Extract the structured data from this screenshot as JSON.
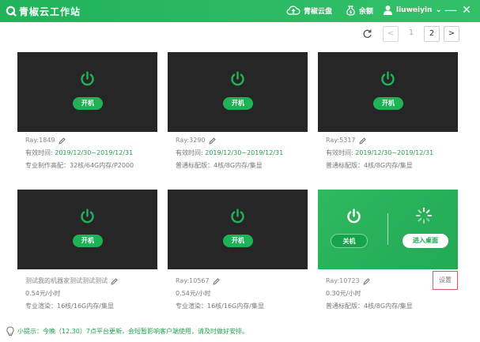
{
  "app": {
    "title": "青椒云工作站",
    "cloud_disk_label": "青椒云盘",
    "balance_label": "余额",
    "username": "liuweiyin",
    "minimize_symbol": "—",
    "close_symbol": "✕",
    "user_dropdown_symbol": "⌄"
  },
  "pagination": {
    "prev": "<",
    "page1": "1",
    "page2": "2",
    "next": ">",
    "current_page": 2
  },
  "start_label": "开机",
  "shutdown_label": "关机",
  "desktop_label": "进入桌面",
  "settings_label": "设置",
  "cards": [
    {
      "name": "Ray:1849",
      "line2_label": "有效时间: ",
      "line2_value": "2019/12/30~2019/12/31",
      "spec": "专业制作高配：32核/64G内存/P2000",
      "status": "off"
    },
    {
      "name": "Ray:3290",
      "line2_label": "有效时间: ",
      "line2_value": "2019/12/30~2019/12/31",
      "spec": "普通标配版：4核/8G内存/集显",
      "status": "off"
    },
    {
      "name": "Ray:5317",
      "line2_label": "有效时间: ",
      "line2_value": "2019/12/30~2019/12/31",
      "spec": "普通标配版：4核/8G内存/集显",
      "status": "off"
    },
    {
      "name": "测试我的机器家测试测试测试",
      "line2_label": "",
      "line2_value": "0.54元/小时",
      "spec": "专业渲染：16核/16G内存/集显",
      "status": "off"
    },
    {
      "name": "Ray:10567",
      "line2_label": "",
      "line2_value": "0.54元/小时",
      "spec": "专业渲染：16核/16G内存/集显",
      "status": "off"
    },
    {
      "name": "Ray:10723",
      "line2_label": "",
      "line2_value": "0.30元/小时",
      "spec": "普通标配版：4核/8G内存/集显",
      "status": "on"
    }
  ],
  "tip": {
    "label": "小提示：",
    "text": "今晚（12.30）7点平台更新，会短暂影响客户端使用，请及时做好安排。"
  },
  "colors": {
    "brand_green": "#21b35a",
    "screen_dark": "#262626",
    "settings_border": "#e05a5a"
  }
}
